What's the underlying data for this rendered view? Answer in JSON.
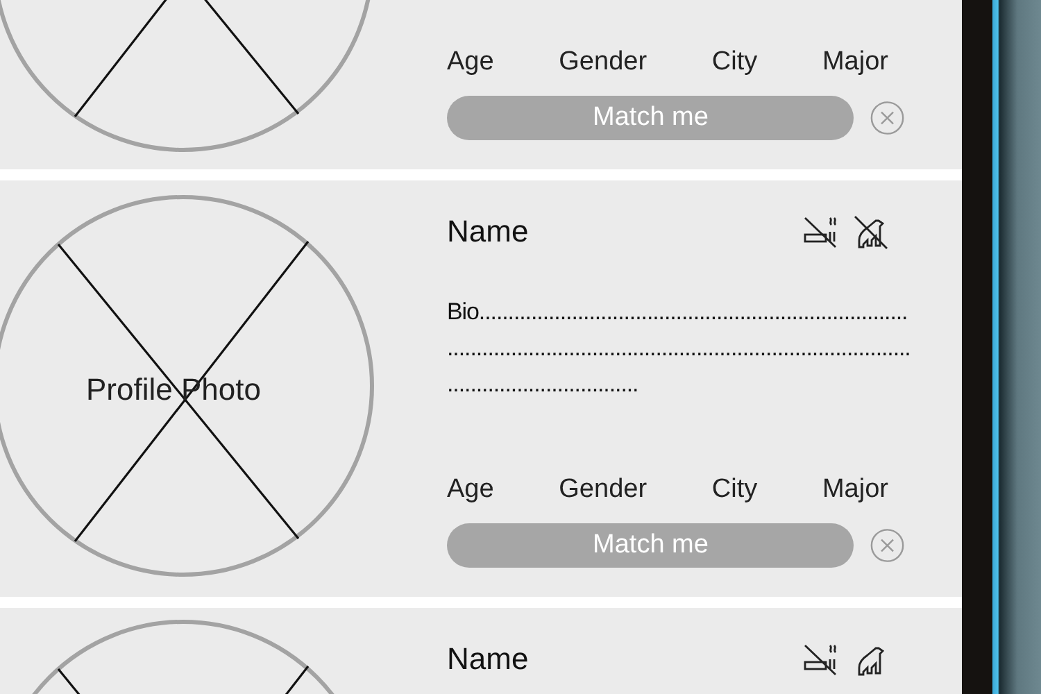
{
  "profiles": [
    {
      "fields": [
        "Age",
        "Gender",
        "City",
        "Major"
      ],
      "button": "Match me"
    },
    {
      "name": "Name",
      "smoking_allowed": false,
      "pets_allowed": false,
      "photo_label": "Profile Photo",
      "bio": "Bio...........................................................................................................................................................................................",
      "fields": [
        "Age",
        "Gender",
        "City",
        "Major"
      ],
      "button": "Match me"
    },
    {
      "name": "Name",
      "smoking_allowed": false,
      "pets_allowed": true
    }
  ]
}
